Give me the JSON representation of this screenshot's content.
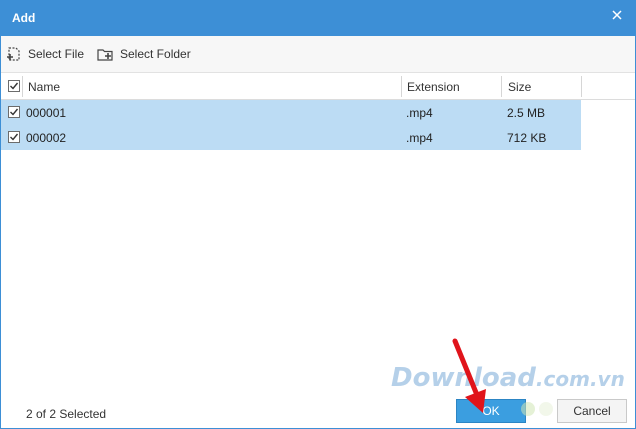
{
  "window": {
    "title": "Add"
  },
  "toolbar": {
    "select_file_label": "Select File",
    "select_folder_label": "Select Folder"
  },
  "table": {
    "columns": [
      "Name",
      "Extension",
      "Size"
    ],
    "rows": [
      {
        "name": "000001",
        "extension": ".mp4",
        "size": "2.5 MB",
        "checked": true
      },
      {
        "name": "000002",
        "extension": ".mp4",
        "size": "712 KB",
        "checked": true
      }
    ]
  },
  "status": {
    "text": "2 of 2 Selected"
  },
  "buttons": {
    "ok_label": "OK",
    "cancel_label": "Cancel"
  },
  "watermark": {
    "main": "Download",
    "suffix": ".com.vn"
  },
  "colors": {
    "titlebar": "#3d8fd6",
    "row_selected": "#bcdcf4",
    "ok_button": "#3b9ee0",
    "annotation_arrow": "#e0141b"
  },
  "icons": {
    "close": "close-icon",
    "select_file": "add-file-icon",
    "select_folder": "add-folder-icon",
    "checkbox": "checkmark-icon"
  }
}
